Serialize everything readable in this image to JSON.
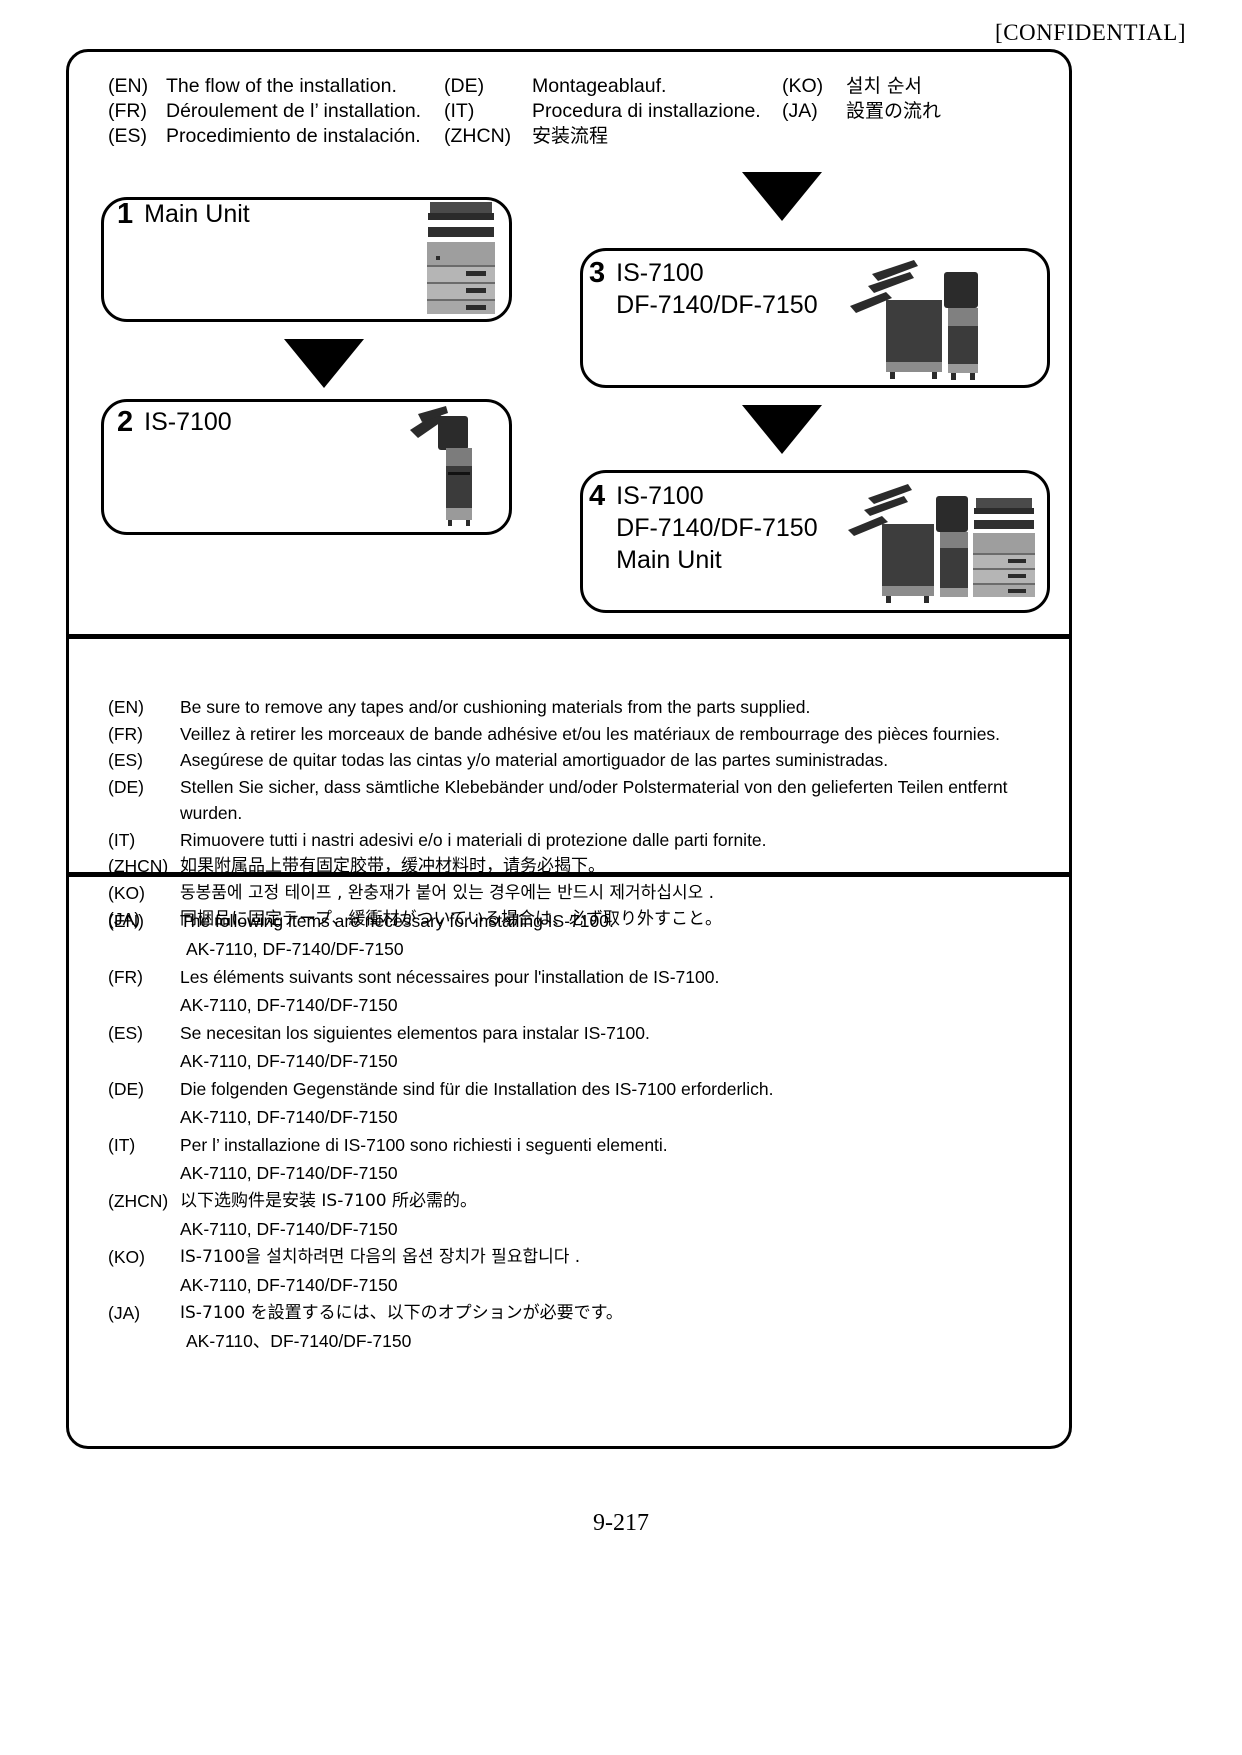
{
  "header": {
    "confidential": "[CONFIDENTIAL]"
  },
  "footer": {
    "page_number": "9-217"
  },
  "titles": [
    {
      "code": "(EN)",
      "text": "The flow of the installation.",
      "code2": "(DE)",
      "text2": "Montageablauf.",
      "code3": "(KO)",
      "text3": "설치 순서"
    },
    {
      "code": "(FR)",
      "text": "Déroulement de l’ installation.",
      "code2": "(IT)",
      "text2": "Procedura di installazione.",
      "code3": "(JA)",
      "text3": "設置の流れ"
    },
    {
      "code": "(ES)",
      "text": "Procedimiento de instalación.",
      "code2": "(ZHCN)",
      "text2": "安装流程",
      "code3": "",
      "text3": ""
    }
  ],
  "flow": {
    "steps": [
      {
        "number": "1",
        "lines": "Main Unit"
      },
      {
        "number": "2",
        "lines": "IS-7100"
      },
      {
        "number": "3",
        "lines": "IS-7100\nDF-7140/DF-7150"
      },
      {
        "number": "4",
        "lines": "IS-7100\nDF-7140/DF-7150\nMain Unit"
      }
    ],
    "arrow_icon": "arrow-down-icon"
  },
  "tapes_note": [
    {
      "code": "(EN)",
      "text": "Be sure to remove any tapes and/or cushioning materials from the parts supplied."
    },
    {
      "code": "(FR)",
      "text": "Veillez à retirer les morceaux de bande adhésive et/ou les matériaux de rembourrage des pièces fournies."
    },
    {
      "code": "(ES)",
      "text": "Asegúrese de quitar todas las cintas y/o material amortiguador de las partes suministradas."
    },
    {
      "code": "(DE)",
      "text": "Stellen Sie sicher, dass sämtliche Klebebänder und/oder Polstermaterial von den gelieferten Teilen entfernt wurden."
    },
    {
      "code": "(IT)",
      "text": "Rimuovere tutti i nastri adesivi e/o i materiali di protezione dalle parti fornite."
    },
    {
      "code": "(ZHCN)",
      "text": "如果附属品上带有固定胶带，缓冲材料时，请务必揭下。"
    },
    {
      "code": "(KO)",
      "text": "동봉품에 고정 테이프 , 완충재가 붙어 있는 경우에는 반드시 제거하십시오 ."
    },
    {
      "code": "(JA)",
      "text": "同梱品に固定テープ、緩衝材がついている場合は、必ず取り外すこと。"
    }
  ],
  "required_items": [
    {
      "code": "(EN)",
      "text": "The following items are necessary for installing IS-7100.",
      "parts": "AK-7110, DF-7140/DF-7150"
    },
    {
      "code": "(FR)",
      "text": "Les éléments suivants sont nécessaires pour l'installation de IS-7100.",
      "parts": "AK-7110, DF-7140/DF-7150"
    },
    {
      "code": "(ES)",
      "text": "Se necesitan los siguientes elementos para instalar IS-7100.",
      "parts": "AK-7110, DF-7140/DF-7150"
    },
    {
      "code": "(DE)",
      "text": "Die folgenden Gegenstände sind für die Installation des IS-7100 erforderlich.",
      "parts": "AK-7110, DF-7140/DF-7150"
    },
    {
      "code": "(IT)",
      "text": "Per l’ installazione di IS-7100 sono richiesti i seguenti elementi.",
      "parts": "AK-7110, DF-7140/DF-7150"
    },
    {
      "code": "(ZHCN)",
      "text": "以下选购件是安装 IS-7100 所必需的。",
      "parts": "AK-7110, DF-7140/DF-7150"
    },
    {
      "code": "(KO)",
      "text": "IS-7100을 설치하려면 다음의 옵션 장치가 필요합니다 .",
      "parts": "AK-7110, DF-7140/DF-7150"
    },
    {
      "code": "(JA)",
      "text": "IS-7100 を設置するには、以下のオプションが必要です。",
      "parts": "AK-7110、DF-7140/DF-7150"
    }
  ],
  "colors": {
    "ink": "#000000",
    "paper": "#ffffff",
    "device_dark": "#3a3a3a",
    "device_mid": "#8a8a8a",
    "device_light": "#bdbdbd"
  }
}
